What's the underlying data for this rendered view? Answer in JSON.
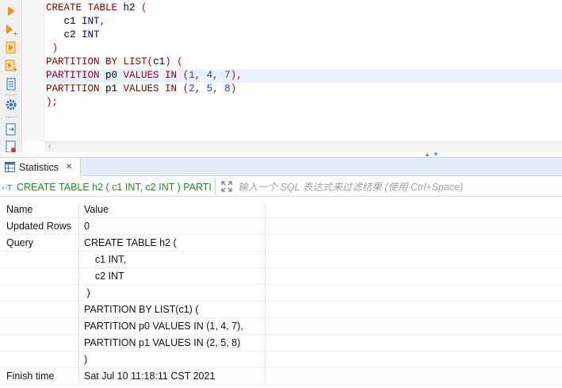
{
  "toolbar": {
    "buttons": [
      {
        "name": "execute-statement-icon",
        "color": "#e39a1c"
      },
      {
        "name": "execute-in-new-tab-icon",
        "color": "#e39a1c"
      },
      {
        "name": "execute-script-icon",
        "color": "#e39a1c"
      },
      {
        "name": "execute-script-new-tab-icon",
        "color": "#e39a1c"
      },
      {
        "name": "explain-plan-icon",
        "color": "#2f6fb6"
      },
      {
        "name": "settings-icon",
        "color": "#2f6fb6"
      },
      {
        "name": "export-icon",
        "color": "#2f6fb6"
      },
      {
        "name": "new-script-icon",
        "color": "#2f6fb6"
      }
    ]
  },
  "editor": {
    "lines": [
      "CREATE TABLE h2 (",
      "    c1 INT,",
      "    c2 INT",
      " )",
      "PARTITION BY LIST(c1) (",
      "PARTITION p0 VALUES IN (1, 4, 7),",
      "PARTITION p1 VALUES IN (2, 5, 8)",
      ");"
    ],
    "current_line_index": 5
  },
  "panel": {
    "tab_label": "Statistics",
    "query_text": "CREATE TABLE h2 ( c1 INT, c2 INT ) PARTI",
    "filter_placeholder": "输入一个 SQL 表达式来过滤结果 (使用 Ctrl+Space)"
  },
  "grid": {
    "columns": [
      "Name",
      "Value"
    ],
    "rows": [
      {
        "name": "Updated Rows",
        "value": "0"
      },
      {
        "name": "Query",
        "value": "CREATE TABLE h2 ("
      },
      {
        "name": "",
        "value": "    c1 INT,"
      },
      {
        "name": "",
        "value": "    c2 INT"
      },
      {
        "name": "",
        "value": " )"
      },
      {
        "name": "",
        "value": "PARTITION BY LIST(c1) ("
      },
      {
        "name": "",
        "value": "PARTITION p0 VALUES IN (1, 4, 7),"
      },
      {
        "name": "",
        "value": "PARTITION p1 VALUES IN (2, 5, 8)"
      },
      {
        "name": "",
        "value": ")"
      },
      {
        "name": "Finish time",
        "value": "Sat Jul 10 11:18:11 CST 2021"
      }
    ]
  },
  "colors": {
    "keyword": "#8b0000",
    "type": "#00008b",
    "number": "#1f39d6",
    "punctuation": "#c00000",
    "current_line": "#e8f2fe",
    "query_chip": "#1a8f1a"
  }
}
